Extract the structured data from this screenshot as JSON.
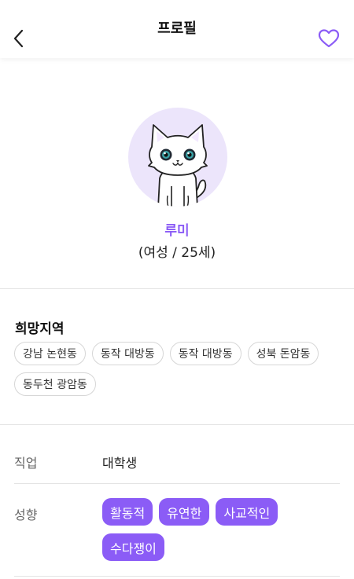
{
  "header": {
    "title": "프로필",
    "back_icon": "chevron-left-icon",
    "favorite_icon": "heart-outline-icon",
    "accent_color": "#8b5cf6"
  },
  "profile": {
    "avatar_icon": "cat-avatar-icon",
    "nickname": "루미",
    "sub_info": "(여성 / 25세)"
  },
  "region": {
    "title": "희망지역",
    "items": [
      "강남 논현동",
      "동작 대방동",
      "동작 대방동",
      "성북 돈암동",
      "동두천 광암동"
    ]
  },
  "details": {
    "job_label": "직업",
    "job_value": "대학생",
    "personality_label": "성향",
    "personality_tags": [
      "활동적",
      "유연한",
      "사교적인",
      "수다쟁이"
    ]
  }
}
